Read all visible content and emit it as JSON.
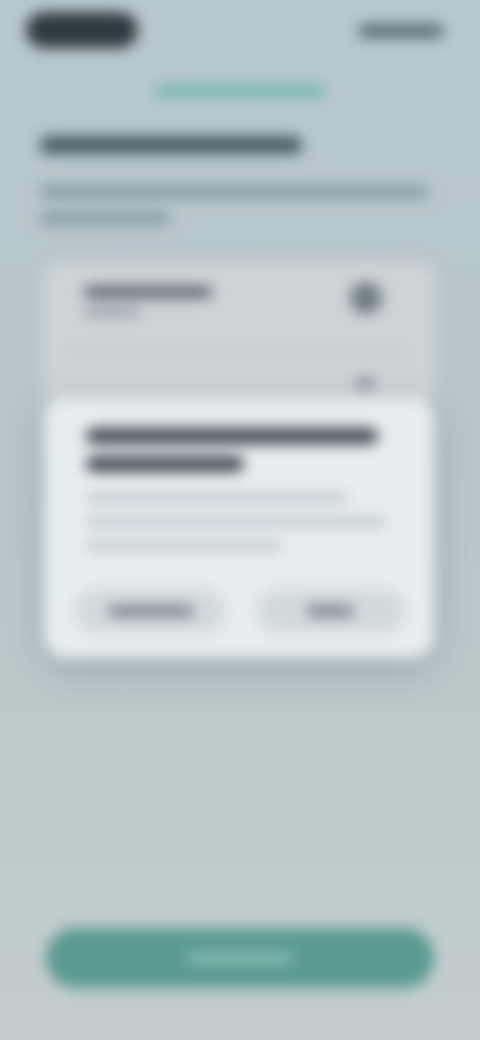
{
  "theme": {
    "background": "#b9c8cf",
    "accent": "#64b6a8",
    "primary_button": "#5a9a91",
    "dialog_background": "#e7ecef",
    "card_background": "#cfd3d7",
    "text_dark": "#3f4b52"
  },
  "status_bar": {
    "time": "",
    "indicators": ""
  },
  "header": {
    "title": "",
    "subtitle": ""
  },
  "card": {
    "title": "",
    "subtitle": ""
  },
  "dialog": {
    "title": "",
    "body": "",
    "secondary_button": "",
    "primary_button": ""
  },
  "footer": {
    "primary_button": ""
  }
}
